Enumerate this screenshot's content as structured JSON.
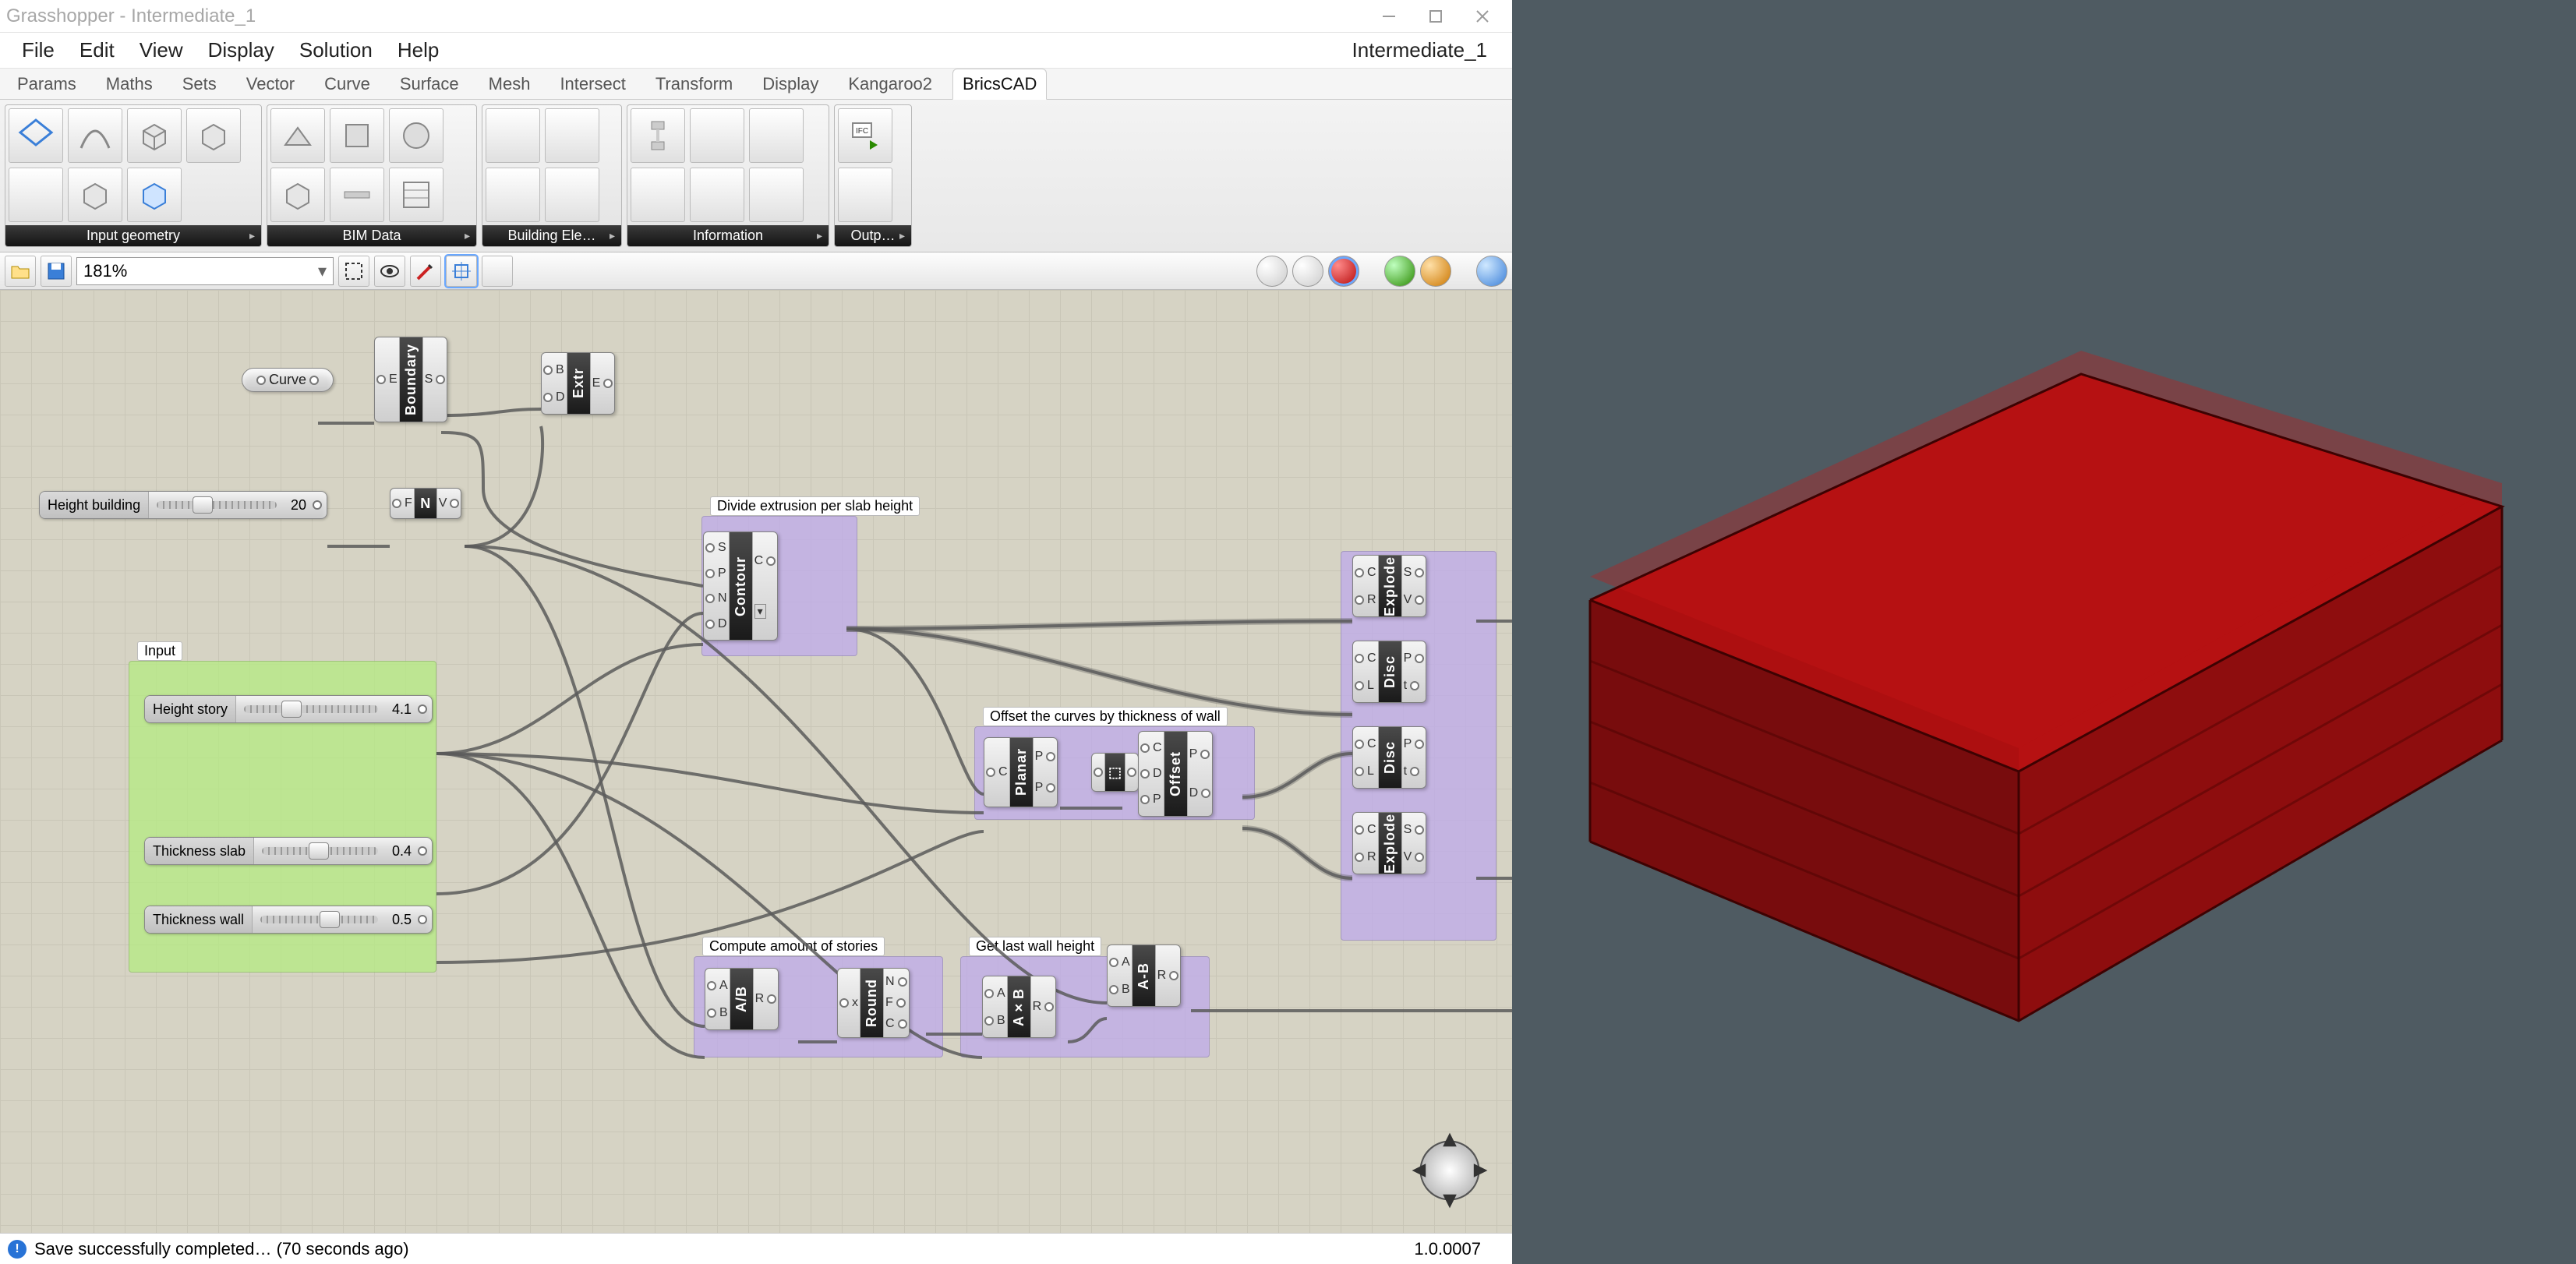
{
  "window": {
    "title": "Grasshopper - Intermediate_1",
    "doc_label": "Intermediate_1"
  },
  "menu": [
    "File",
    "Edit",
    "View",
    "Display",
    "Solution",
    "Help"
  ],
  "category_tabs": [
    "Params",
    "Maths",
    "Sets",
    "Vector",
    "Curve",
    "Surface",
    "Mesh",
    "Intersect",
    "Transform",
    "Display",
    "Kangaroo2",
    "BricsCAD"
  ],
  "active_tab": "BricsCAD",
  "ribbon_groups": [
    {
      "label": "Input geometry",
      "buttons": [
        "point-param",
        "curve-param",
        "brep-param",
        "surf-param",
        "mesh-param",
        "geom-param",
        "solid-param"
      ]
    },
    {
      "label": "BIM Data",
      "buttons": [
        "bim-get",
        "bim-set",
        "bim-filter",
        "bim-info",
        "bim-list",
        "bim-profile",
        "bim-table"
      ]
    },
    {
      "label": "Building Ele…",
      "buttons": [
        "bld-a",
        "bld-b",
        "bld-c",
        "bld-d"
      ]
    },
    {
      "label": "Information",
      "buttons": [
        "info-a",
        "info-b",
        "info-c",
        "info-d",
        "info-e",
        "info-f"
      ]
    },
    {
      "label": "Outp…",
      "buttons": [
        "ifc-export",
        "out-settings"
      ]
    }
  ],
  "canvas_toolbar": {
    "zoom": "181%"
  },
  "sliders": {
    "height_building": {
      "label": "Height building",
      "value": "20"
    },
    "height_story": {
      "label": "Height story",
      "value": "4.1"
    },
    "thickness_slab": {
      "label": "Thickness slab",
      "value": "0.4"
    },
    "thickness_wall": {
      "label": "Thickness wall",
      "value": "0.5"
    }
  },
  "params": {
    "curve": "Curve"
  },
  "group_labels": {
    "input": "Input",
    "divide": "Divide extrusion per slab height",
    "offset": "Offset the curves by thickness of wall",
    "stories": "Compute amount of stories",
    "lastwall": "Get last wall height"
  },
  "components": {
    "boundary": "Boundary",
    "extr": "Extr",
    "neg": "N",
    "contour": "Contour",
    "explode1": "Explode",
    "explode2": "Explode",
    "disc1": "Disc",
    "disc2": "Disc",
    "planar": "Planar",
    "offset": "Offset",
    "div": "A/B",
    "round": "Round",
    "mul": "A×B",
    "sub": "A-B"
  },
  "port_labels": {
    "E": "E",
    "S": "S",
    "B": "B",
    "D": "D",
    "F": "F",
    "N": "N",
    "V": "V",
    "P": "P",
    "C": "C",
    "x": "x",
    "R": "R",
    "L": "L",
    "t": "t",
    "A": "A"
  },
  "statusbar": {
    "msg": "Save successfully completed… (70 seconds ago)",
    "version": "1.0.0007"
  }
}
